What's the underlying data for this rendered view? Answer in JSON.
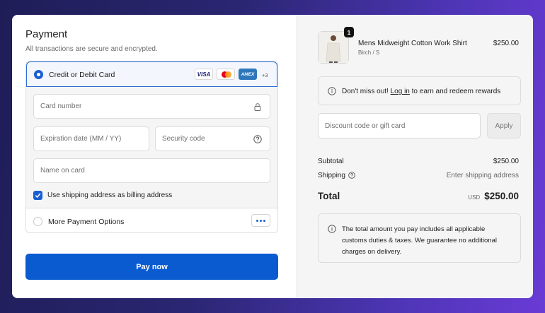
{
  "payment": {
    "title": "Payment",
    "subtitle": "All transactions are secure and encrypted.",
    "card_option": {
      "label": "Credit or Debit Card",
      "brands": [
        "VISA",
        "mastercard",
        "AMEX"
      ],
      "more_brands": "+3",
      "selected": true
    },
    "fields": {
      "card_number": "Card number",
      "expiration": "Expiration date (MM / YY)",
      "security_code": "Security code",
      "name_on_card": "Name on card"
    },
    "billing_checkbox": {
      "label": "Use shipping address as billing address",
      "checked": true
    },
    "more_option": {
      "label": "More Payment Options"
    },
    "pay_button": "Pay now"
  },
  "summary": {
    "product": {
      "name": "Mens Midweight Cotton Work Shirt",
      "variant": "Birch / S",
      "price": "$250.00",
      "quantity": "1"
    },
    "rewards": {
      "before": "Don't miss out! ",
      "link": "Log in",
      "after": " to earn and redeem rewards"
    },
    "discount": {
      "placeholder": "Discount code or gift card",
      "apply": "Apply"
    },
    "subtotal": {
      "label": "Subtotal",
      "value": "$250.00"
    },
    "shipping": {
      "label": "Shipping",
      "value": "Enter shipping address"
    },
    "total": {
      "label": "Total",
      "currency": "USD",
      "value": "$250.00"
    },
    "duties_note": "The total amount you pay includes all applicable customs duties & taxes. We guarantee no additional charges on delivery."
  },
  "colors": {
    "accent": "#0a5bd0",
    "selected_border": "#2f6fd4"
  }
}
